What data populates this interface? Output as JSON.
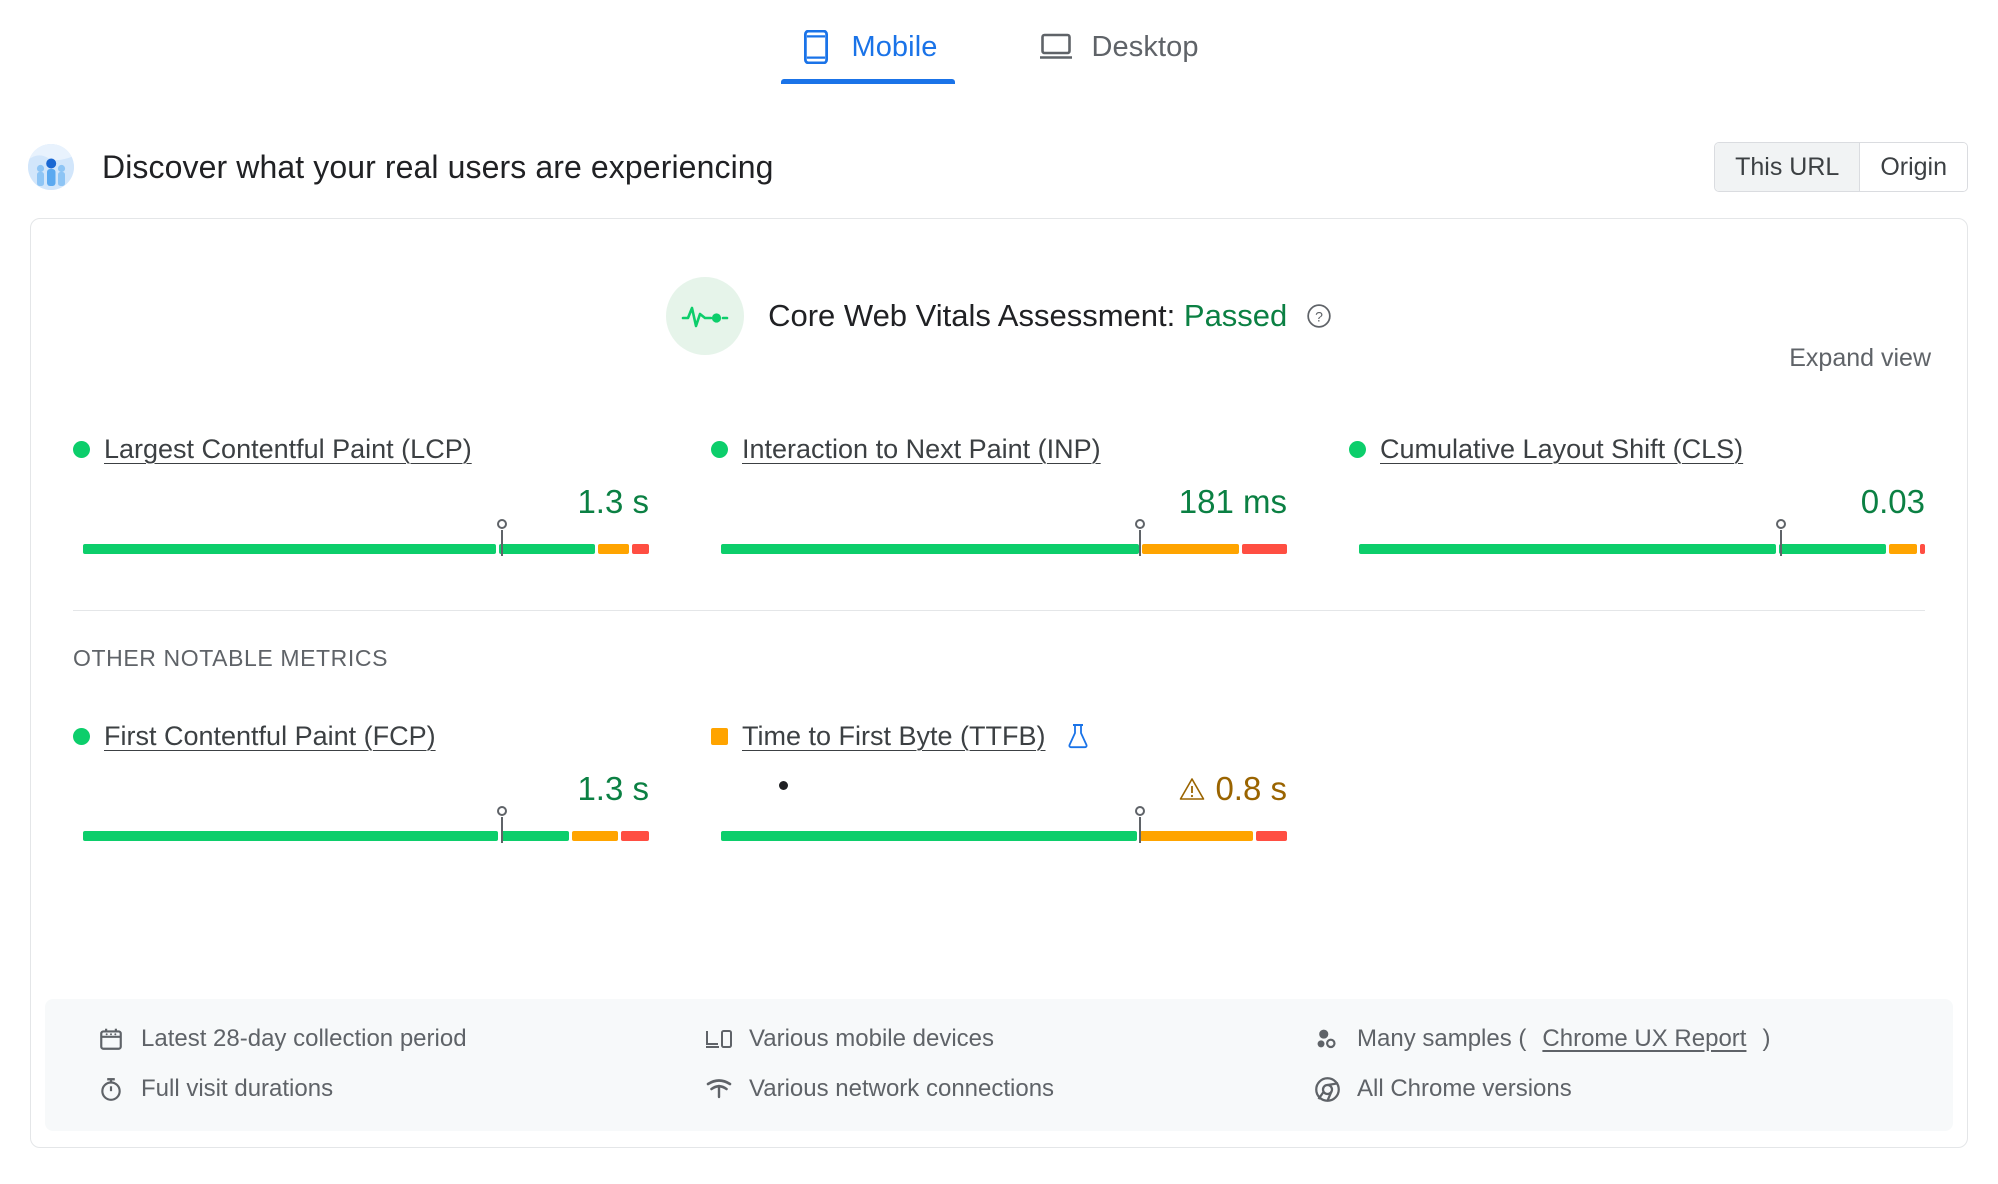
{
  "device_tabs": [
    {
      "label": "Mobile",
      "icon": "mobile-icon",
      "active": true
    },
    {
      "label": "Desktop",
      "icon": "desktop-icon",
      "active": false
    }
  ],
  "discover": {
    "title": "Discover what your real users are experiencing",
    "icon": "real-users-icon",
    "scope": {
      "selected": "This URL",
      "options": [
        "This URL",
        "Origin"
      ]
    }
  },
  "assessment": {
    "icon": "pulse-icon",
    "label": "Core Web Vitals Assessment:",
    "status": "Passed",
    "status_color": "#0b8043",
    "help_icon": "help-icon",
    "expand_view": "Expand view"
  },
  "core_metrics": [
    {
      "name": "Largest Contentful Paint (LCP)",
      "marker": "dot",
      "marker_color": "#0cce6b",
      "value": "1.3 s",
      "value_color": "#0b8043",
      "warning": false,
      "needle_pct": 74.5,
      "segments": [
        {
          "rating": "good",
          "pct": 73.0,
          "color": "#0cce6b"
        },
        {
          "rating": "good",
          "pct": 17.0,
          "color": "#0cce6b"
        },
        {
          "rating": "avg",
          "pct": 5.5,
          "color": "#ffa400"
        },
        {
          "rating": "poor",
          "pct": 3.0,
          "color": "#ff4e42"
        }
      ]
    },
    {
      "name": "Interaction to Next Paint (INP)",
      "marker": "dot",
      "marker_color": "#0cce6b",
      "value": "181 ms",
      "value_color": "#0b8043",
      "warning": false,
      "needle_pct": 74.5,
      "segments": [
        {
          "rating": "good",
          "pct": 73.5,
          "color": "#0cce6b"
        },
        {
          "rating": "avg",
          "pct": 17.0,
          "color": "#ffa400"
        },
        {
          "rating": "poor",
          "pct": 8.0,
          "color": "#ff4e42"
        }
      ]
    },
    {
      "name": "Cumulative Layout Shift (CLS)",
      "marker": "dot",
      "marker_color": "#0cce6b",
      "value": "0.03",
      "value_color": "#0b8043",
      "warning": false,
      "needle_pct": 75.0,
      "segments": [
        {
          "rating": "good",
          "pct": 74.0,
          "color": "#0cce6b"
        },
        {
          "rating": "good",
          "pct": 19.0,
          "color": "#0cce6b"
        },
        {
          "rating": "avg",
          "pct": 5.0,
          "color": "#ffa400"
        },
        {
          "rating": "poor",
          "pct": 0.9,
          "color": "#ff4e42"
        }
      ]
    }
  ],
  "other_metrics_label": "OTHER NOTABLE METRICS",
  "other_metrics": [
    {
      "name": "First Contentful Paint (FCP)",
      "marker": "dot",
      "marker_color": "#0cce6b",
      "value": "1.3 s",
      "value_color": "#0b8043",
      "warning": false,
      "beaker": false,
      "needle_pct": 74.5,
      "segments": [
        {
          "rating": "good",
          "pct": 73.0,
          "color": "#0cce6b"
        },
        {
          "rating": "good",
          "pct": 12.0,
          "color": "#0cce6b"
        },
        {
          "rating": "avg",
          "pct": 8.0,
          "color": "#ffa400"
        },
        {
          "rating": "poor",
          "pct": 5.0,
          "color": "#ff4e42"
        }
      ]
    },
    {
      "name": "Time to First Byte (TTFB)",
      "marker": "square",
      "marker_color": "#ffa400",
      "value": "0.8 s",
      "value_color": "#9a6400",
      "warning": true,
      "warning_icon": "warning-triangle-icon",
      "beaker": true,
      "beaker_icon": "beaker-icon",
      "needle_pct": 74.5,
      "segments": [
        {
          "rating": "good",
          "pct": 73.5,
          "color": "#0cce6b"
        },
        {
          "rating": "avg",
          "pct": 20.0,
          "color": "#ffa400"
        },
        {
          "rating": "poor",
          "pct": 5.5,
          "color": "#ff4e42"
        }
      ]
    }
  ],
  "footer": [
    {
      "icon": "calendar-icon",
      "text": "Latest 28-day collection period",
      "link": null
    },
    {
      "icon": "devices-icon",
      "text": "Various mobile devices",
      "link": null
    },
    {
      "icon": "samples-icon",
      "text": "Many samples (",
      "link": "Chrome UX Report",
      "text_after": ")"
    },
    {
      "icon": "stopwatch-icon",
      "text": "Full visit durations",
      "link": null
    },
    {
      "icon": "network-icon",
      "text": "Various network connections",
      "link": null
    },
    {
      "icon": "chrome-icon",
      "text": "All Chrome versions",
      "link": null
    }
  ]
}
